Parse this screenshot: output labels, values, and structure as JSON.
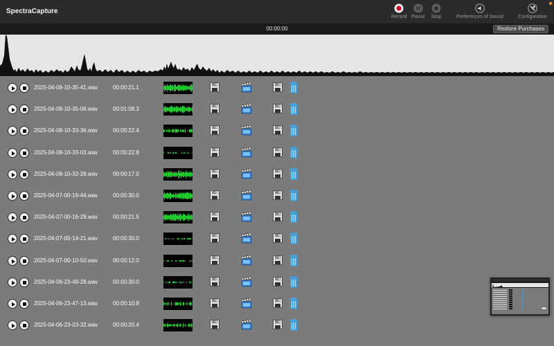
{
  "app": {
    "title": "SpectraCapture"
  },
  "toolbar": {
    "record_label": "Record",
    "pause_label": "Pause",
    "stop_label": "Stop",
    "preferences_label": "Preferences of Sound",
    "configuration_label": "Configuration",
    "record_color": "#e0002a"
  },
  "timer": {
    "value": "00:00:00"
  },
  "restore_button": {
    "label": "Restore Purchases"
  },
  "recordings": [
    {
      "filename": "2025-04-08-10-35-41.wav",
      "duration": "00:00:21.1"
    },
    {
      "filename": "2025-04-08-10-35-06.wav",
      "duration": "00:01:08.3"
    },
    {
      "filename": "2025-04-08-10-33-36.wav",
      "duration": "00:00:22.4"
    },
    {
      "filename": "2025-04-08-10-33-03.wav",
      "duration": "00:00:22.8"
    },
    {
      "filename": "2025-04-08-10-32-28.wav",
      "duration": "00:00:17.0"
    },
    {
      "filename": "2025-04-07-00-19-44.wav",
      "duration": "00:00:30.0"
    },
    {
      "filename": "2025-04-07-00-16-29.wav",
      "duration": "00:00:21.5"
    },
    {
      "filename": "2025-04-07-00-14-21.wav",
      "duration": "00:00:30.0"
    },
    {
      "filename": "2025-04-07-00-10-50.wav",
      "duration": "00:00:12.0"
    },
    {
      "filename": "2025-04-06-23-48-28.wav",
      "duration": "00:00:30.0"
    },
    {
      "filename": "2025-04-06-23-47-13.wav",
      "duration": "00:00:10.8"
    },
    {
      "filename": "2025-04-06-23-03-32.wav",
      "duration": "00:00:20.4"
    }
  ],
  "icons": {
    "play": "play-icon",
    "stop": "stop-icon",
    "waveform_thumbnail": "waveform-thumbnail",
    "save": "floppy-disk-icon",
    "export": "clapperboard-icon",
    "save_alt": "floppy-disk-icon",
    "delete": "trash-icon"
  },
  "colors": {
    "waveform_thumb": "#22e030",
    "trash": "#3aa6e8",
    "export_blue": "#2f7fd6"
  }
}
